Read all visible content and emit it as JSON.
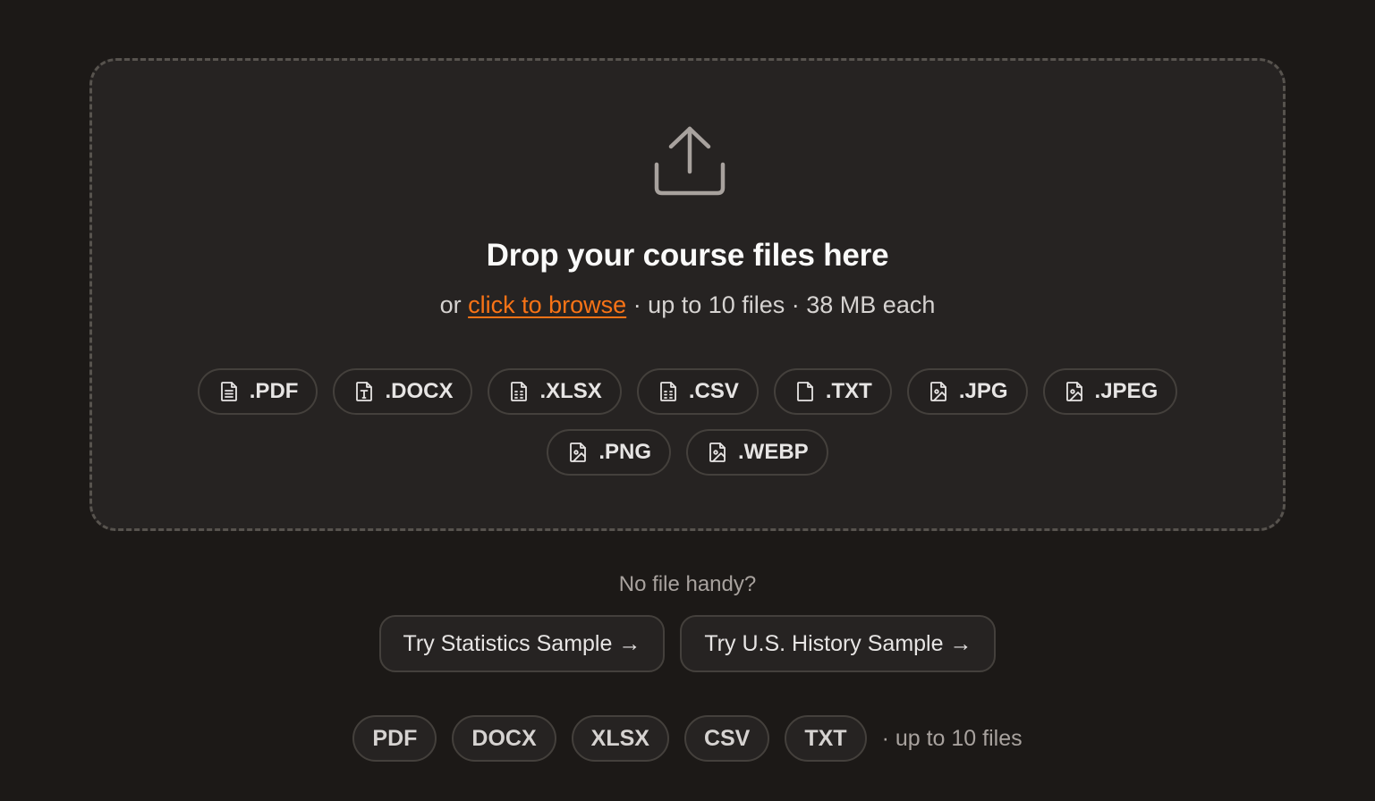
{
  "dropzone": {
    "title": "Drop your course files here",
    "subtitle_prefix": "or ",
    "browse_link": "click to browse",
    "subtitle_suffix": " · up to 10 files · 38 MB each",
    "formats_row1": [
      {
        "label": ".PDF",
        "icon": "file-text-icon"
      },
      {
        "label": ".DOCX",
        "icon": "file-type-icon"
      },
      {
        "label": ".XLSX",
        "icon": "file-spreadsheet-icon"
      },
      {
        "label": ".CSV",
        "icon": "file-spreadsheet-icon"
      },
      {
        "label": ".TXT",
        "icon": "file-icon"
      },
      {
        "label": ".JPG",
        "icon": "file-image-icon"
      },
      {
        "label": ".JPEG",
        "icon": "file-image-icon"
      }
    ],
    "formats_row2": [
      {
        "label": ".PNG",
        "icon": "file-image-icon"
      },
      {
        "label": ".WEBP",
        "icon": "file-image-icon"
      }
    ]
  },
  "samples": {
    "prompt": "No file handy?",
    "statistics_label": "Try Statistics Sample →",
    "history_label": "Try U.S. History Sample →"
  },
  "footer": {
    "tags": [
      "PDF",
      "DOCX",
      "XLSX",
      "CSV",
      "TXT"
    ],
    "note": "· up to 10 files"
  },
  "colors": {
    "background": "#1c1917",
    "accent": "#f97316"
  }
}
